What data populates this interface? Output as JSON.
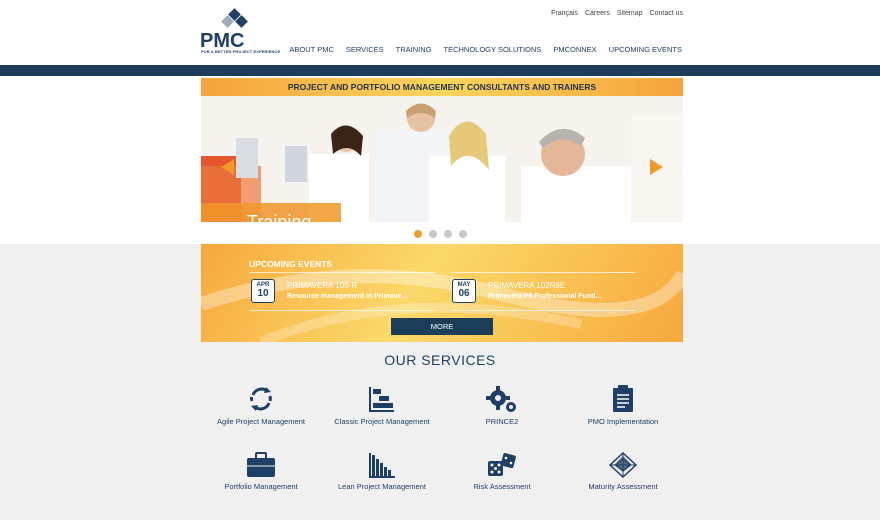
{
  "logo": {
    "text": "PMC",
    "tagline": "FOR A BETTER PROJECT EXPERIENCE"
  },
  "top_links": [
    "Français",
    "Careers",
    "Sitemap",
    "Contact us"
  ],
  "main_nav": [
    "ABOUT PMC",
    "SERVICES",
    "TRAINING",
    "TECHNOLOGY SOLUTIONS",
    "PMCONNEX",
    "UPCOMING EVENTS"
  ],
  "banner": {
    "title": "PROJECT AND PORTFOLIO MANAGEMENT CONSULTANTS AND TRAINERS",
    "caption": "Training"
  },
  "carousel": {
    "dots": 4,
    "active": 0
  },
  "events": {
    "title": "UPCOMING EVENTS",
    "items": [
      {
        "month": "APR",
        "day": "10",
        "name": "PRIMAVERA 106-R",
        "desc": "Resource management in Primave..."
      },
      {
        "month": "MAY",
        "day": "06",
        "name": "PRIMAVERA 102R8E",
        "desc": "Primavera P6 Professional Fund..."
      }
    ],
    "more_label": "MORE"
  },
  "services": {
    "title": "OUR SERVICES",
    "items": [
      {
        "label": "Agile Project Management",
        "icon": "cycle-arrows-icon"
      },
      {
        "label": "Classic Project Management",
        "icon": "gantt-chart-icon"
      },
      {
        "label": "PRINCE2",
        "icon": "gears-icon"
      },
      {
        "label": "PMO Implementation",
        "icon": "clipboard-icon"
      },
      {
        "label": "Portfolio Management",
        "icon": "briefcase-icon"
      },
      {
        "label": "Lean Project Management",
        "icon": "bar-chart-icon"
      },
      {
        "label": "Risk Assessment",
        "icon": "dice-icon"
      },
      {
        "label": "Maturity Assessment",
        "icon": "radar-icon"
      }
    ]
  },
  "colors": {
    "navy": "#1b3d5a",
    "orange": "#f39a25",
    "text_blue": "#1e3f66"
  }
}
